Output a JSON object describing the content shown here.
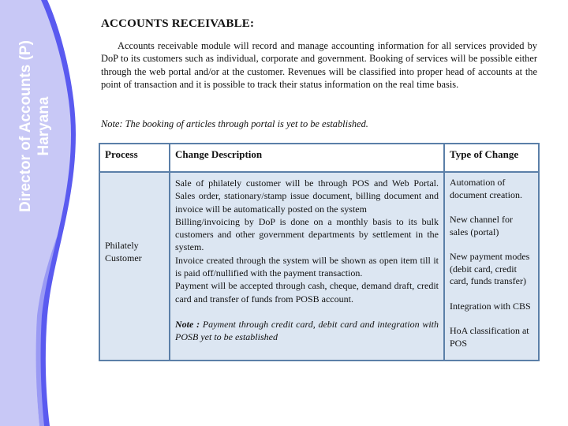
{
  "sidebar": {
    "title_line1": "Director of Accounts (P)",
    "title_line2": "Haryana",
    "colors": {
      "band": "#c8c8f6",
      "edge_dark": "#5a5af0",
      "edge_light": "#9a9af4"
    }
  },
  "heading": "ACCOUNTS RECEIVABLE:",
  "intro": "Accounts receivable module will record and manage accounting information for all services provided by DoP to its customers such as individual, corporate and government. Booking of services will be possible either through the web portal and/or at the customer. Revenues will be classified into proper head of accounts at the point of transaction and it is possible to track their status information on the real time basis.",
  "note": "Note: The booking of articles through portal is yet to be established.",
  "table": {
    "headers": [
      "Process",
      "Change Description",
      "Type of Change"
    ],
    "rows": [
      {
        "process": "Philately Customer",
        "description": [
          "Sale of philately customer will be through POS and Web Portal. Sales order, stationary/stamp issue document, billing document and invoice will be automatically posted on the system",
          "Billing/invoicing by DoP is done on a monthly basis to its bulk customers and other government departments by settlement in the system.",
          "Invoice created through the system will be shown as open item till it is paid off/nullified with the payment transaction.",
          "Payment will be accepted through cash, cheque, demand draft, credit card and transfer of funds from POSB account."
        ],
        "note_label": "Note :",
        "note_text": "Payment through credit card, debit card and integration with POSB yet to be established",
        "types": [
          "Automation of document creation.",
          "New channel for sales (portal)",
          "New payment modes (debit card, credit card, funds transfer)",
          "Integration with CBS",
          "HoA classification at POS"
        ]
      }
    ],
    "colors": {
      "border": "#5b7fa8",
      "header_bg": "#ffffff",
      "cell_bg": "#dce6f2"
    }
  }
}
